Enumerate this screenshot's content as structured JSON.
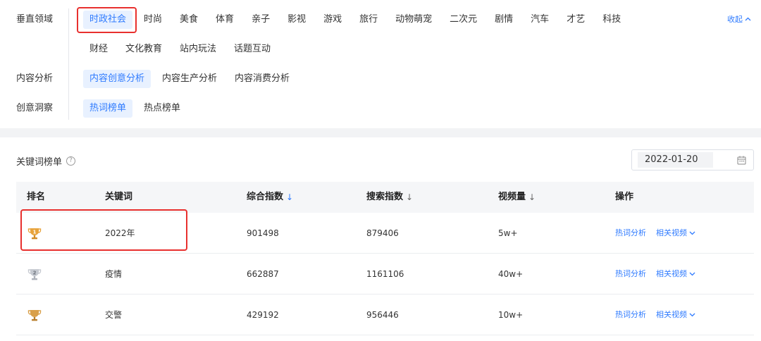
{
  "filters": {
    "vertical": {
      "label": "垂直领域",
      "tags_row1": [
        "时政社会",
        "时尚",
        "美食",
        "体育",
        "亲子",
        "影视",
        "游戏",
        "旅行",
        "动物萌宠",
        "二次元",
        "剧情",
        "汽车",
        "才艺",
        "科技"
      ],
      "tags_row2": [
        "财经",
        "文化教育",
        "站内玩法",
        "话题互动"
      ]
    },
    "analysis": {
      "label": "内容分析",
      "tags": [
        "内容创意分析",
        "内容生产分析",
        "内容消费分析"
      ]
    },
    "insight": {
      "label": "创意洞察",
      "tags": [
        "热词榜单",
        "热点榜单"
      ]
    },
    "collapse_label": "收起"
  },
  "list": {
    "title": "关键词榜单",
    "help": "?",
    "date": "2022-01-20",
    "columns": {
      "rank": "排名",
      "keyword": "关键词",
      "composite": "综合指数",
      "search": "搜索指数",
      "video": "视频量",
      "ops": "操作"
    },
    "sort_arrow": "↓",
    "rows": [
      {
        "rank_badge": "1",
        "keyword": "2022年",
        "composite": "901498",
        "search": "879406",
        "video": "5w+"
      },
      {
        "rank_badge": "2",
        "keyword": "疫情",
        "composite": "662887",
        "search": "1161106",
        "video": "40w+"
      },
      {
        "rank_badge": "",
        "keyword": "交警",
        "composite": "429192",
        "search": "956446",
        "video": "10w+"
      }
    ],
    "op_hot": "热词分析",
    "op_related": "相关视频"
  },
  "colors": {
    "accent": "#2f7bff",
    "highlight": "#e8302e",
    "gold": "#e8a33c",
    "silver": "#b9bec7"
  }
}
